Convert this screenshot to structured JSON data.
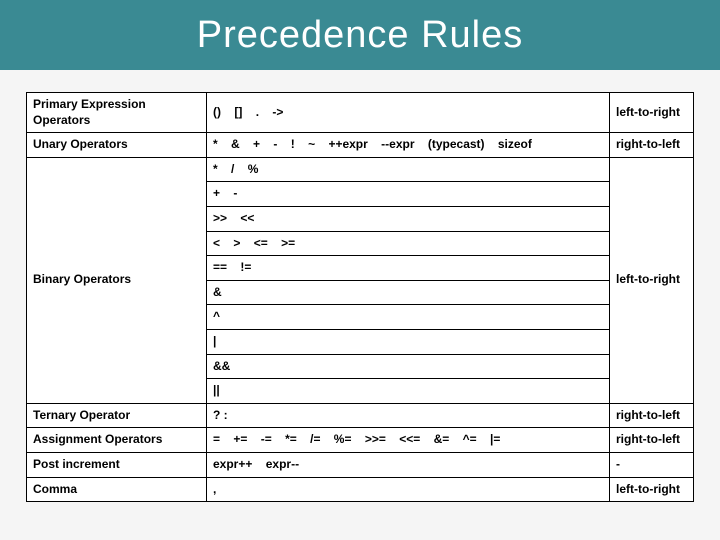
{
  "title": "Precedence Rules",
  "rows": [
    {
      "category": "Primary Expression Operators",
      "ops": [
        "()",
        "[]",
        ".",
        "->"
      ],
      "assoc": "left-to-right"
    },
    {
      "category": "Unary Operators",
      "ops": [
        "*",
        "&",
        "+",
        "-",
        "!",
        "~",
        "++expr",
        "--expr",
        "(typecast)",
        "sizeof"
      ],
      "assoc": "right-to-left"
    },
    {
      "category": "Binary Operators",
      "group": [
        [
          "*",
          "/",
          "%"
        ],
        [
          "+",
          "-"
        ],
        [
          ">>",
          "<<"
        ],
        [
          "<",
          ">",
          "<=",
          ">="
        ],
        [
          "==",
          "!="
        ],
        [
          "&"
        ],
        [
          "^"
        ],
        [
          "|"
        ],
        [
          "&&"
        ],
        [
          "||"
        ]
      ],
      "assoc": "left-to-right"
    },
    {
      "category": "Ternary Operator",
      "ops": [
        "? :"
      ],
      "assoc": "right-to-left"
    },
    {
      "category": "Assignment Operators",
      "ops": [
        "=",
        "+=",
        "-=",
        "*=",
        "/=",
        "%=",
        ">>=",
        "<<=",
        "&=",
        "^=",
        "|="
      ],
      "assoc": "right-to-left"
    },
    {
      "category": "Post increment",
      "ops": [
        "expr++",
        "expr--"
      ],
      "assoc": "-"
    },
    {
      "category": "Comma",
      "ops": [
        ","
      ],
      "assoc": "left-to-right"
    }
  ]
}
